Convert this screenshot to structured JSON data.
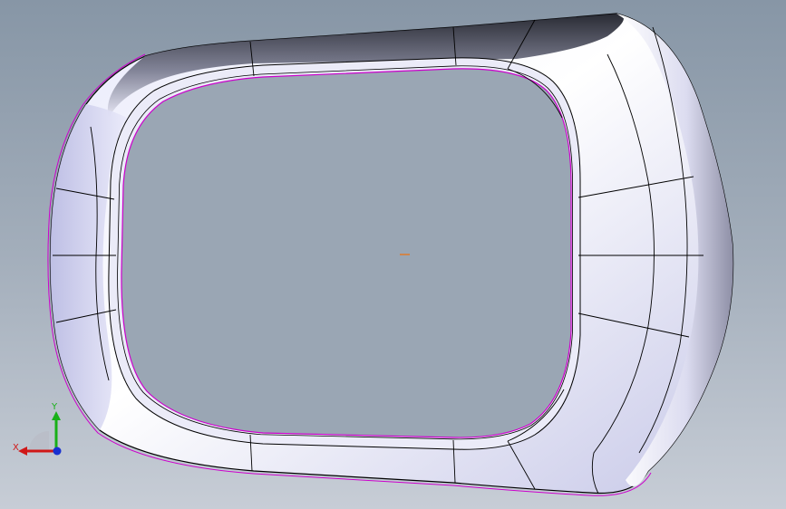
{
  "viewport": {
    "background_top": "#8796a6",
    "background_bottom": "#c7cdd6",
    "model_shading_light": "#f4f4ff",
    "model_shading_dark": "#2a2d38",
    "model_edge_color": "#000000",
    "selection_edge_color": "#cc00cc",
    "origin_marker_color": "#e07a2a"
  },
  "triad": {
    "x_label": "X",
    "y_label": "Y",
    "x_color": "#d01818",
    "y_color": "#18b018",
    "z_color": "#1830d0"
  }
}
